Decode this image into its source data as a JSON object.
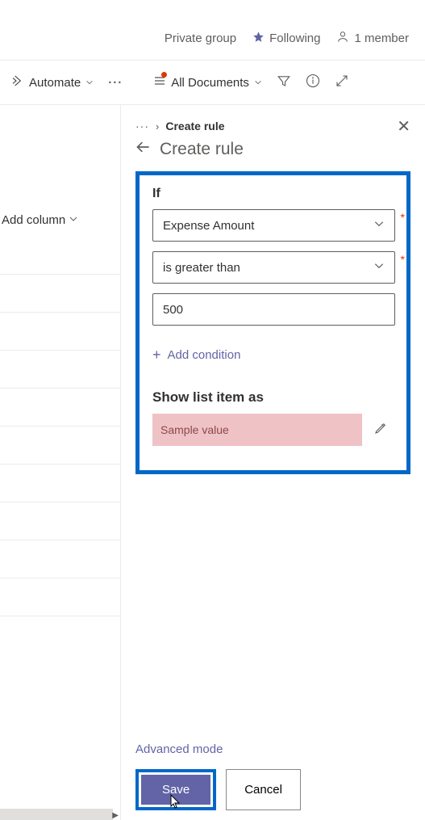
{
  "header": {
    "group_type": "Private group",
    "following_label": "Following",
    "member_count": "1 member"
  },
  "command_bar": {
    "automate_label": "Automate",
    "view_label": "All Documents"
  },
  "left": {
    "add_column_label": "Add column"
  },
  "panel": {
    "breadcrumb_current": "Create rule",
    "title": "Create rule",
    "if_label": "If",
    "column_select": "Expense Amount",
    "operator_select": "is greater than",
    "value_input": "500",
    "add_condition_label": "Add condition",
    "show_as_label": "Show list item as",
    "preview_text": "Sample value",
    "advanced_label": "Advanced mode",
    "save_label": "Save",
    "cancel_label": "Cancel",
    "colors": {
      "highlight_border": "#0068c8",
      "accent": "#6264a7",
      "preview_bg": "#efc2c6"
    }
  }
}
